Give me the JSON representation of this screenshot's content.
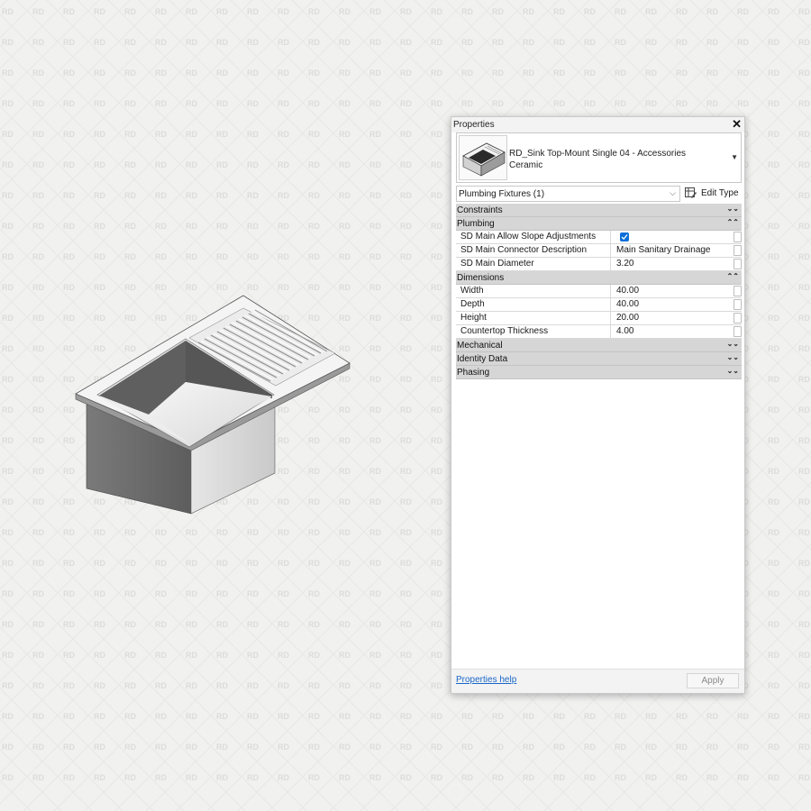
{
  "watermark": "RD",
  "panel": {
    "title": "Properties",
    "close_icon": "close-icon",
    "type_selector": {
      "line1": "RD_Sink Top-Mount Single 04 - Accessories",
      "line2": "Ceramic"
    },
    "instance_filter": "Plumbing Fixtures (1)",
    "edit_type_label": "Edit Type",
    "groups": [
      {
        "label": "Constraints",
        "expanded": false,
        "rows": []
      },
      {
        "label": "Plumbing",
        "expanded": true,
        "rows": [
          {
            "name": "SD Main Allow Slope Adjustments",
            "value": "",
            "checkbox": true,
            "checked": true
          },
          {
            "name": "SD Main Connector Description",
            "value": "Main Sanitary Drainage"
          },
          {
            "name": "SD Main Diameter",
            "value": "3.20"
          }
        ]
      },
      {
        "label": "Dimensions",
        "expanded": true,
        "rows": [
          {
            "name": "Width",
            "value": "40.00"
          },
          {
            "name": "Depth",
            "value": "40.00"
          },
          {
            "name": "Height",
            "value": "20.00"
          },
          {
            "name": "Countertop Thickness",
            "value": "4.00"
          }
        ]
      },
      {
        "label": "Mechanical",
        "expanded": false,
        "rows": []
      },
      {
        "label": "Identity Data",
        "expanded": false,
        "rows": []
      },
      {
        "label": "Phasing",
        "expanded": false,
        "rows": []
      }
    ],
    "help_link": "Properties help",
    "apply_label": "Apply"
  },
  "colors": {
    "background": "#f1f1f0",
    "group_header": "#d6d6d6",
    "checkbox": "#0a6fd8",
    "link": "#1a66c6"
  }
}
